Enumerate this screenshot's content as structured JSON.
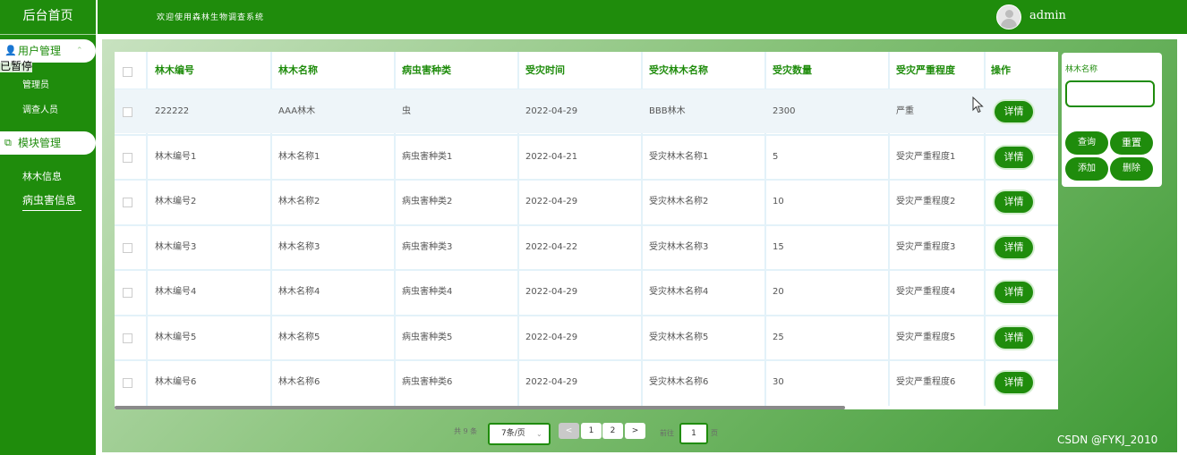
{
  "sidebar": {
    "brand": "后台首页",
    "groups": [
      {
        "label": "用户管理",
        "icon": "user-icon",
        "expanded": true,
        "items": [
          "管理员",
          "调查人员"
        ]
      },
      {
        "label": "模块管理",
        "icon": "copy-icon",
        "items": [
          "林木信息",
          "病虫害信息"
        ]
      }
    ],
    "overlay_text": "已暂停"
  },
  "header": {
    "welcome": "欢迎使用森林生物调查系统",
    "username": "admin"
  },
  "table": {
    "columns": [
      "林木编号",
      "林木名称",
      "病虫害种类",
      "受灾时间",
      "受灾林木名称",
      "受灾数量",
      "受灾严重程度",
      "操作"
    ],
    "rows": [
      [
        "222222",
        "AAA林木",
        "虫",
        "2022-04-29",
        "BBB林木",
        "2300",
        "严重"
      ],
      [
        "林木编号1",
        "林木名称1",
        "病虫害种类1",
        "2022-04-21",
        "受灾林木名称1",
        "5",
        "受灾严重程度1"
      ],
      [
        "林木编号2",
        "林木名称2",
        "病虫害种类2",
        "2022-04-29",
        "受灾林木名称2",
        "10",
        "受灾严重程度2"
      ],
      [
        "林木编号3",
        "林木名称3",
        "病虫害种类3",
        "2022-04-22",
        "受灾林木名称3",
        "15",
        "受灾严重程度3"
      ],
      [
        "林木编号4",
        "林木名称4",
        "病虫害种类4",
        "2022-04-29",
        "受灾林木名称4",
        "20",
        "受灾严重程度4"
      ],
      [
        "林木编号5",
        "林木名称5",
        "病虫害种类5",
        "2022-04-29",
        "受灾林木名称5",
        "25",
        "受灾严重程度5"
      ],
      [
        "林木编号6",
        "林木名称6",
        "病虫害种类6",
        "2022-04-29",
        "受灾林木名称6",
        "30",
        "受灾严重程度6"
      ]
    ],
    "detail_label": "详情"
  },
  "search": {
    "label": "林木名称",
    "value": "",
    "buttons": {
      "query": "查询",
      "reset": "重置",
      "add": "添加",
      "delete": "删除"
    }
  },
  "pagination": {
    "total": "共 9 条",
    "page_size": "7条/页",
    "prev": "<",
    "pages": [
      "1",
      "2"
    ],
    "next": ">",
    "goto_prefix": "前往",
    "goto_value": "1",
    "goto_suffix": "页"
  },
  "watermark": "CSDN @FYKJ_2010",
  "colors": {
    "primary": "#1f8c0c"
  }
}
